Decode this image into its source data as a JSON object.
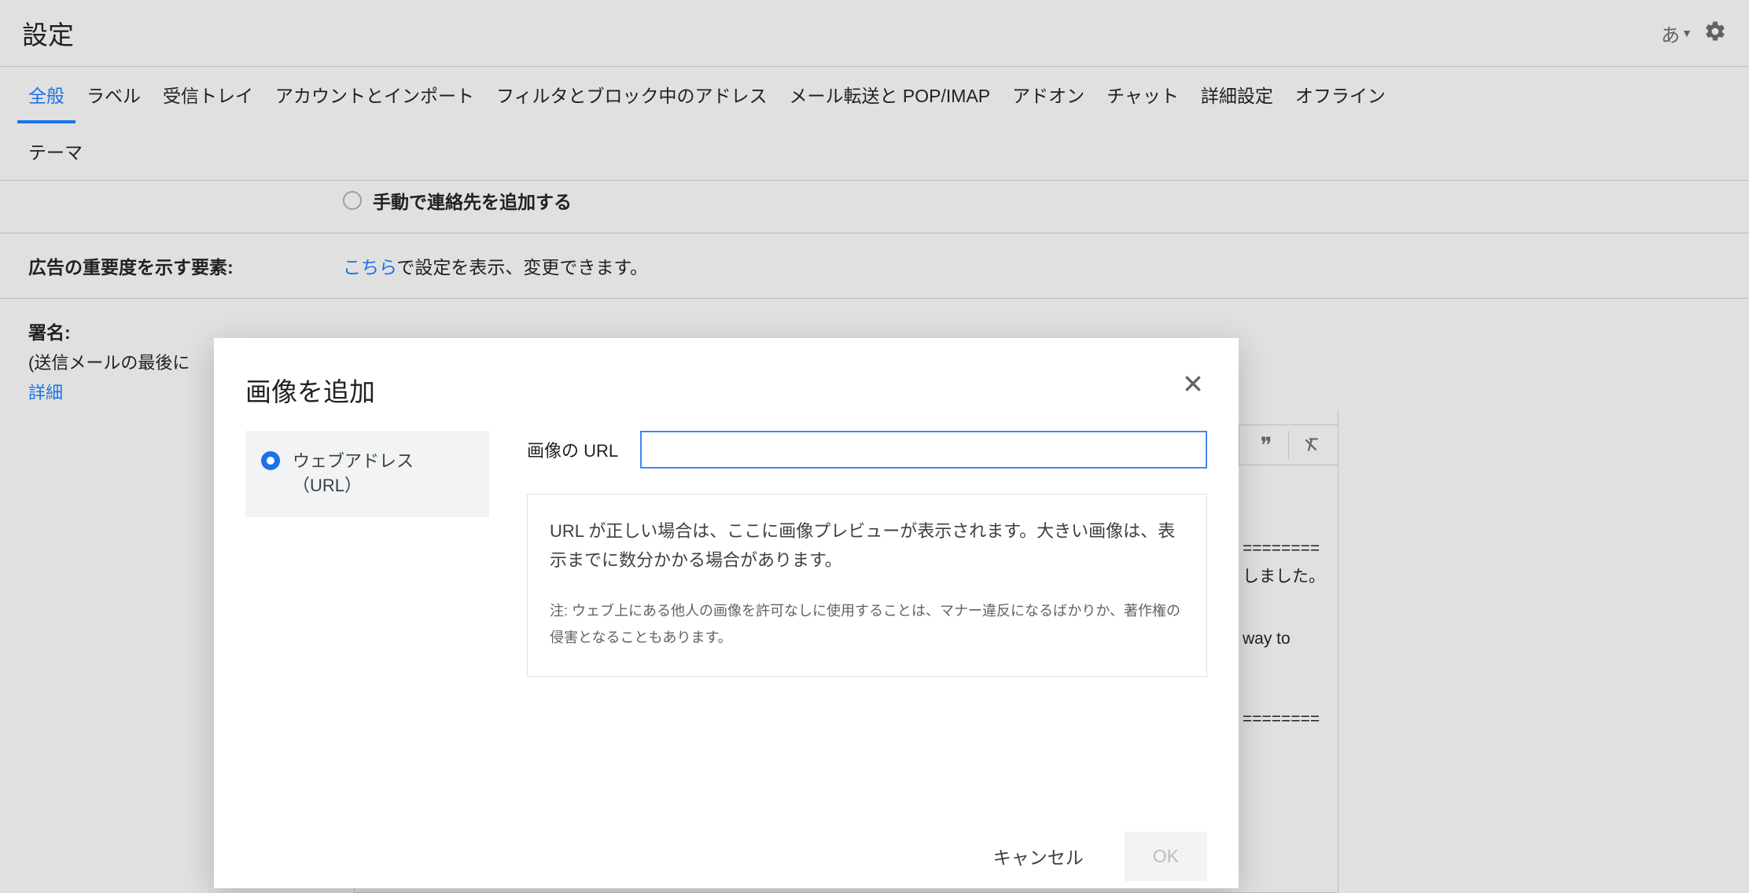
{
  "header": {
    "title": "設定",
    "lang_switch": "あ"
  },
  "tabs": {
    "row1": [
      "全般",
      "ラベル",
      "受信トレイ",
      "アカウントとインポート",
      "フィルタとブロック中のアドレス",
      "メール転送と POP/IMAP",
      "アドオン",
      "チャット",
      "詳細設定",
      "オフライン"
    ],
    "row2": [
      "テーマ"
    ],
    "active_index": 0
  },
  "content": {
    "partial_option": "手動で連絡先を追加する",
    "ads_label": "広告の重要度を示す要素:",
    "ads_link": "こちら",
    "ads_text_after": "で設定を表示、変更できます。",
    "signature_label": "署名:",
    "signature_sub": "(送信メールの最後に",
    "signature_detail": "詳細",
    "sig_text1": "========",
    "sig_text2": "しました。",
    "sig_text3": "way to",
    "sig_text4": "========"
  },
  "modal": {
    "title": "画像を追加",
    "radio_label": "ウェブアドレス（URL）",
    "url_label": "画像の URL",
    "url_value": "",
    "preview_text": "URL が正しい場合は、ここに画像プレビューが表示されます。大きい画像は、表示までに数分かかる場合があります。",
    "preview_note": "注: ウェブ上にある他人の画像を許可なしに使用することは、マナー違反になるばかりか、著作権の侵害となることもあります。",
    "cancel": "キャンセル",
    "ok": "OK"
  }
}
